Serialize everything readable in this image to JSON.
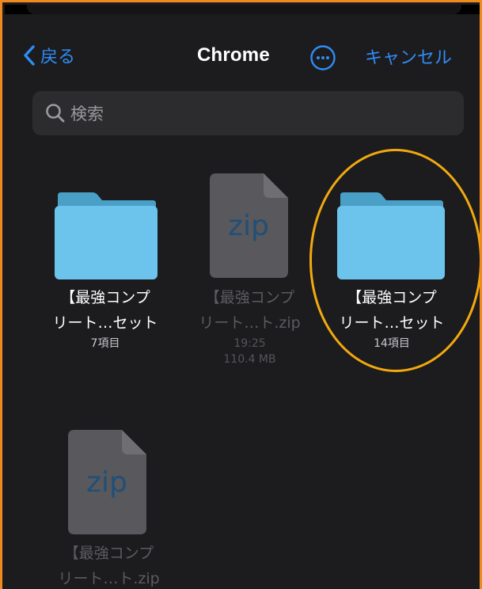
{
  "nav": {
    "back_label": "戻る",
    "title": "Chrome",
    "cancel_label": "キャンセル"
  },
  "search": {
    "placeholder": "検索"
  },
  "items": [
    {
      "type": "folder",
      "name_line1": "【最強コンプ",
      "name_line2": "リート…セット",
      "meta1": "7項目"
    },
    {
      "type": "zip",
      "icon_text": "zip",
      "name_line1": "【最強コンプ",
      "name_line2": "リート…ト.zip",
      "meta1": "19:25",
      "meta2": "110.4 MB"
    },
    {
      "type": "folder",
      "name_line1": "【最強コンプ",
      "name_line2": "リート…セット",
      "meta1": "14項目"
    },
    {
      "type": "zip",
      "icon_text": "zip",
      "name_line1": "【最強コンプ",
      "name_line2": "リート…ト.zip"
    }
  ],
  "colors": {
    "accent": "#2f8cf6",
    "highlight": "#f2a90f",
    "frame_border": "#ef8a1f",
    "folder": "#6cc4ec"
  }
}
